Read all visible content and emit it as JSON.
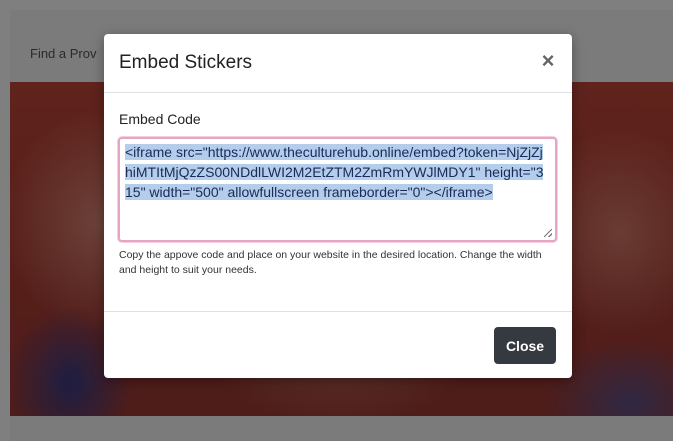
{
  "background_page": {
    "header_text": "Find a Prov"
  },
  "modal": {
    "title": "Embed Stickers",
    "close_icon": "close-icon",
    "field_label": "Embed Code",
    "embed_code": "<iframe src=\"https://www.theculturehub.online/embed?token=NjZjZjhiMTItMjQzZS00NDdlLWI2M2EtZTM2ZmRmYWJlMDY1\" height=\"315\" width=\"500\" allowfullscreen frameborder=\"0\"></iframe>",
    "help_text": "Copy the appove code and place on your website in the desired location. Change the width and height to suit your needs.",
    "close_button_label": "Close"
  },
  "colors": {
    "button_bg": "#343a40",
    "textarea_focus_border": "#e7a5c4",
    "selection_highlight": "#b3cdea"
  }
}
